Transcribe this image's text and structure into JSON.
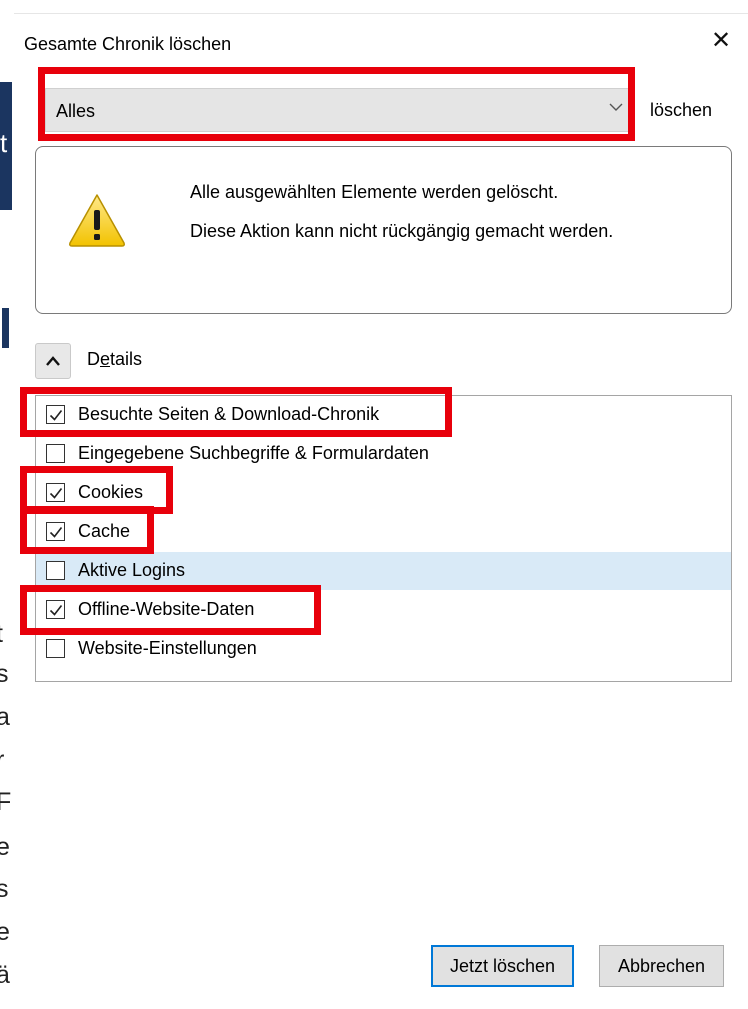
{
  "dialog": {
    "title": "Gesamte Chronik löschen",
    "close_icon": "close-icon"
  },
  "range": {
    "selected": "Alles",
    "label": "löschen"
  },
  "warning": {
    "icon": "warning-icon",
    "line1": "Alle ausgewählten Elemente werden gelöscht.",
    "line2": "Diese Aktion kann nicht rückgängig gemacht werden."
  },
  "details": {
    "label_first": "D",
    "label_underlined": "e",
    "label_rest": "tails",
    "expanded": true
  },
  "items": [
    {
      "label": "Besuchte Seiten & Download-Chronik",
      "checked": true
    },
    {
      "label": "Eingegebene Suchbegriffe & Formulardaten",
      "checked": false
    },
    {
      "label": "Cookies",
      "checked": true
    },
    {
      "label": "Cache",
      "checked": true
    },
    {
      "label": "Aktive Logins",
      "checked": false,
      "highlighted": true
    },
    {
      "label": "Offline-Website-Daten",
      "checked": true
    },
    {
      "label": "Website-Einstellungen",
      "checked": false
    }
  ],
  "buttons": {
    "confirm": "Jetzt löschen",
    "cancel": "Abbrechen"
  },
  "background_fragments": [
    "t",
    "l",
    "t",
    "s",
    "a",
    "r",
    "F",
    "e",
    "s",
    "e",
    "ä"
  ],
  "colors": {
    "annotation": "#e8000b",
    "focus": "#0078d7",
    "highlight": "#d9eaf7",
    "page_navy": "#1b3560"
  }
}
